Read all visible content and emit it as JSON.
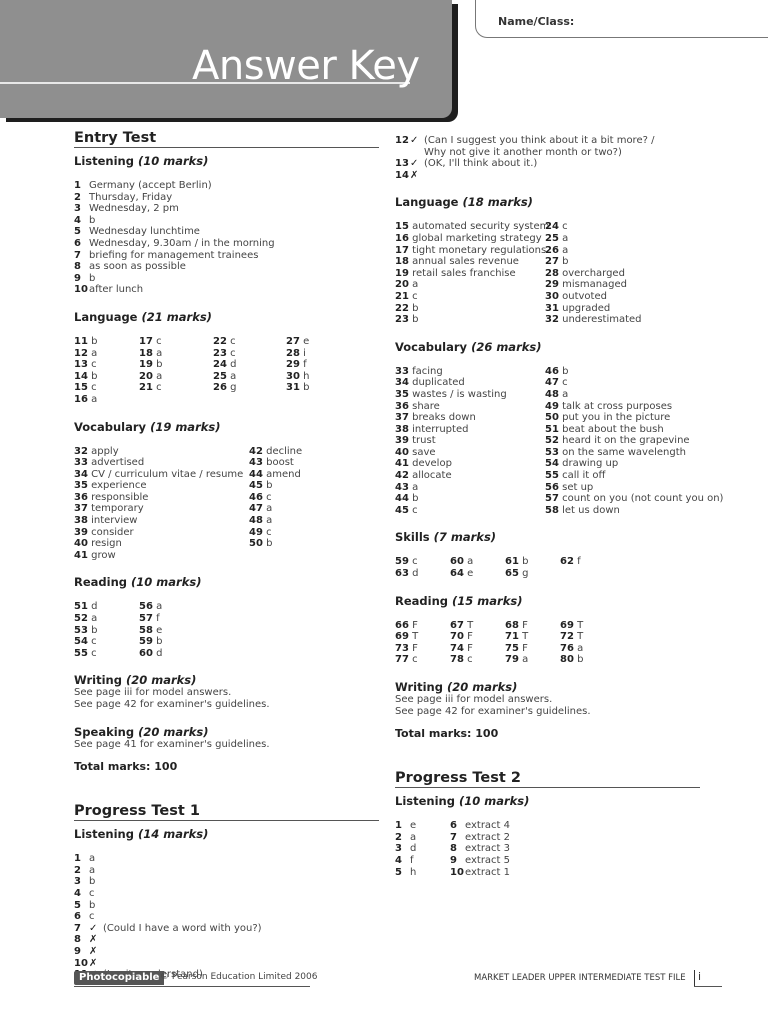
{
  "header": {
    "title": "Answer Key",
    "name_label": "Name/Class:"
  },
  "entry_test": {
    "title": "Entry Test",
    "listening": {
      "label": "Listening",
      "marks": "(10 marks)",
      "items": [
        {
          "n": "1",
          "a": "Germany (accept Berlin)"
        },
        {
          "n": "2",
          "a": "Thursday, Friday"
        },
        {
          "n": "3",
          "a": "Wednesday, 2 pm"
        },
        {
          "n": "4",
          "a": "b"
        },
        {
          "n": "5",
          "a": "Wednesday lunchtime"
        },
        {
          "n": "6",
          "a": "Wednesday, 9.30am / in the morning"
        },
        {
          "n": "7",
          "a": "briefing for management trainees"
        },
        {
          "n": "8",
          "a": "as soon as possible"
        },
        {
          "n": "9",
          "a": "b"
        },
        {
          "n": "10",
          "a": "after lunch"
        }
      ]
    },
    "language": {
      "label": "Language",
      "marks": "(21 marks)",
      "items": [
        {
          "n": "11",
          "a": "b"
        },
        {
          "n": "17",
          "a": "c"
        },
        {
          "n": "22",
          "a": "c"
        },
        {
          "n": "27",
          "a": "e"
        },
        {
          "n": "12",
          "a": "a"
        },
        {
          "n": "18",
          "a": "a"
        },
        {
          "n": "23",
          "a": "c"
        },
        {
          "n": "28",
          "a": "i"
        },
        {
          "n": "13",
          "a": "c"
        },
        {
          "n": "19",
          "a": "b"
        },
        {
          "n": "24",
          "a": "d"
        },
        {
          "n": "29",
          "a": "f"
        },
        {
          "n": "14",
          "a": "b"
        },
        {
          "n": "20",
          "a": "a"
        },
        {
          "n": "25",
          "a": "a"
        },
        {
          "n": "30",
          "a": "h"
        },
        {
          "n": "15",
          "a": "c"
        },
        {
          "n": "21",
          "a": "c"
        },
        {
          "n": "26",
          "a": "g"
        },
        {
          "n": "31",
          "a": "b"
        },
        {
          "n": "16",
          "a": "a"
        }
      ]
    },
    "vocabulary": {
      "label": "Vocabulary",
      "marks": "(19 marks)",
      "items": [
        {
          "n": "32",
          "a": "apply"
        },
        {
          "n": "42",
          "a": "decline"
        },
        {
          "n": "33",
          "a": "advertised"
        },
        {
          "n": "43",
          "a": "boost"
        },
        {
          "n": "34",
          "a": "CV / curriculum vitae / resume"
        },
        {
          "n": "44",
          "a": "amend"
        },
        {
          "n": "35",
          "a": "experience"
        },
        {
          "n": "45",
          "a": "b"
        },
        {
          "n": "36",
          "a": "responsible"
        },
        {
          "n": "46",
          "a": "c"
        },
        {
          "n": "37",
          "a": "temporary"
        },
        {
          "n": "47",
          "a": "a"
        },
        {
          "n": "38",
          "a": "interview"
        },
        {
          "n": "48",
          "a": "a"
        },
        {
          "n": "39",
          "a": "consider"
        },
        {
          "n": "49",
          "a": "c"
        },
        {
          "n": "40",
          "a": "resign"
        },
        {
          "n": "50",
          "a": "b"
        },
        {
          "n": "41",
          "a": "grow"
        }
      ]
    },
    "reading": {
      "label": "Reading",
      "marks": "(10 marks)",
      "items": [
        {
          "n": "51",
          "a": "d"
        },
        {
          "n": "56",
          "a": "a"
        },
        {
          "n": "52",
          "a": "a"
        },
        {
          "n": "57",
          "a": "f"
        },
        {
          "n": "53",
          "a": "b"
        },
        {
          "n": "58",
          "a": "e"
        },
        {
          "n": "54",
          "a": "c"
        },
        {
          "n": "59",
          "a": "b"
        },
        {
          "n": "55",
          "a": "c"
        },
        {
          "n": "60",
          "a": "d"
        }
      ]
    },
    "writing": {
      "label": "Writing",
      "marks": "(20 marks)",
      "lines": [
        "See page iii for model answers.",
        "See page 42 for examiner's guidelines."
      ]
    },
    "speaking": {
      "label": "Speaking",
      "marks": "(20 marks)",
      "lines": [
        "See page 41 for examiner's guidelines."
      ]
    },
    "total": "Total marks: 100"
  },
  "progress_test_1": {
    "title": "Progress Test 1",
    "listening": {
      "label": "Listening",
      "marks": "(14 marks)",
      "items": [
        {
          "n": "1",
          "m": "",
          "a": "a"
        },
        {
          "n": "2",
          "m": "",
          "a": "a"
        },
        {
          "n": "3",
          "m": "",
          "a": "b"
        },
        {
          "n": "4",
          "m": "",
          "a": "c"
        },
        {
          "n": "5",
          "m": "",
          "a": "b"
        },
        {
          "n": "6",
          "m": "",
          "a": "c"
        },
        {
          "n": "7",
          "m": "✓",
          "a": "(Could I have a word with you?)"
        },
        {
          "n": "8",
          "m": "✗",
          "a": ""
        },
        {
          "n": "9",
          "m": "✗",
          "a": ""
        },
        {
          "n": "10",
          "m": "✗",
          "a": ""
        },
        {
          "n": "11",
          "m": "✓",
          "a": "(I quite understand)"
        },
        {
          "n": "12",
          "m": "✓",
          "a": "(Can I suggest you think about it a bit more? / Why not give it another month or two?)"
        },
        {
          "n": "13",
          "m": "✓",
          "a": "(OK, I'll think about it.)"
        },
        {
          "n": "14",
          "m": "✗",
          "a": ""
        }
      ]
    },
    "language": {
      "label": "Language",
      "marks": "(18 marks)",
      "items": [
        {
          "n": "15",
          "a": "automated security system"
        },
        {
          "n": "24",
          "a": "c"
        },
        {
          "n": "16",
          "a": "global marketing strategy"
        },
        {
          "n": "25",
          "a": "a"
        },
        {
          "n": "17",
          "a": "tight monetary regulations"
        },
        {
          "n": "26",
          "a": "a"
        },
        {
          "n": "18",
          "a": "annual sales revenue"
        },
        {
          "n": "27",
          "a": "b"
        },
        {
          "n": "19",
          "a": "retail sales franchise"
        },
        {
          "n": "28",
          "a": "overcharged"
        },
        {
          "n": "20",
          "a": "a"
        },
        {
          "n": "29",
          "a": "mismanaged"
        },
        {
          "n": "21",
          "a": "c"
        },
        {
          "n": "30",
          "a": "outvoted"
        },
        {
          "n": "22",
          "a": "b"
        },
        {
          "n": "31",
          "a": "upgraded"
        },
        {
          "n": "23",
          "a": "b"
        },
        {
          "n": "32",
          "a": "underestimated"
        }
      ]
    },
    "vocabulary": {
      "label": "Vocabulary",
      "marks": "(26 marks)",
      "items": [
        {
          "n": "33",
          "a": "facing"
        },
        {
          "n": "46",
          "a": "b"
        },
        {
          "n": "34",
          "a": "duplicated"
        },
        {
          "n": "47",
          "a": "c"
        },
        {
          "n": "35",
          "a": "wastes / is wasting"
        },
        {
          "n": "48",
          "a": "a"
        },
        {
          "n": "36",
          "a": "share"
        },
        {
          "n": "49",
          "a": "talk at cross purposes"
        },
        {
          "n": "37",
          "a": "breaks down"
        },
        {
          "n": "50",
          "a": "put you in the picture"
        },
        {
          "n": "38",
          "a": "interrupted"
        },
        {
          "n": "51",
          "a": "beat about the bush"
        },
        {
          "n": "39",
          "a": "trust"
        },
        {
          "n": "52",
          "a": "heard it on the grapevine"
        },
        {
          "n": "40",
          "a": "save"
        },
        {
          "n": "53",
          "a": "on the same wavelength"
        },
        {
          "n": "41",
          "a": "develop"
        },
        {
          "n": "54",
          "a": "drawing up"
        },
        {
          "n": "42",
          "a": "allocate"
        },
        {
          "n": "55",
          "a": "call it off"
        },
        {
          "n": "43",
          "a": "a"
        },
        {
          "n": "56",
          "a": "set up"
        },
        {
          "n": "44",
          "a": "b"
        },
        {
          "n": "57",
          "a": "count on you (not count you on)"
        },
        {
          "n": "45",
          "a": "c"
        },
        {
          "n": "58",
          "a": "let us down"
        }
      ]
    },
    "skills": {
      "label": "Skills",
      "marks": "(7 marks)",
      "items": [
        {
          "n": "59",
          "a": "c"
        },
        {
          "n": "60",
          "a": "a"
        },
        {
          "n": "61",
          "a": "b"
        },
        {
          "n": "62",
          "a": "f"
        },
        {
          "n": "63",
          "a": "d"
        },
        {
          "n": "64",
          "a": "e"
        },
        {
          "n": "65",
          "a": "g"
        }
      ]
    },
    "reading": {
      "label": "Reading",
      "marks": "(15 marks)",
      "items": [
        {
          "n": "66",
          "a": "F"
        },
        {
          "n": "67",
          "a": "T"
        },
        {
          "n": "68",
          "a": "F"
        },
        {
          "n": "69",
          "a": "T"
        },
        {
          "n": "69",
          "a": "T"
        },
        {
          "n": "70",
          "a": "F"
        },
        {
          "n": "71",
          "a": "T"
        },
        {
          "n": "72",
          "a": "T"
        },
        {
          "n": "73",
          "a": "F"
        },
        {
          "n": "74",
          "a": "F"
        },
        {
          "n": "75",
          "a": "F"
        },
        {
          "n": "76",
          "a": "a"
        },
        {
          "n": "77",
          "a": "c"
        },
        {
          "n": "78",
          "a": "c"
        },
        {
          "n": "79",
          "a": "a"
        },
        {
          "n": "80",
          "a": "b"
        }
      ]
    },
    "writing": {
      "label": "Writing",
      "marks": "(20 marks)",
      "lines": [
        "See page iii for model answers.",
        "See page 42 for examiner's guidelines."
      ]
    },
    "total": "Total marks: 100"
  },
  "progress_test_2": {
    "title": "Progress Test 2",
    "listening": {
      "label": "Listening",
      "marks": "(10 marks)",
      "items": [
        {
          "n": "1",
          "a": "e"
        },
        {
          "n": "6",
          "a": "extract 4"
        },
        {
          "n": "2",
          "a": "a"
        },
        {
          "n": "7",
          "a": "extract 2"
        },
        {
          "n": "3",
          "a": "d"
        },
        {
          "n": "8",
          "a": "extract 3"
        },
        {
          "n": "4",
          "a": "f"
        },
        {
          "n": "9",
          "a": "extract 5"
        },
        {
          "n": "5",
          "a": "h"
        },
        {
          "n": "10",
          "a": "extract 1"
        }
      ]
    }
  },
  "footer": {
    "badge": "Photocopiable",
    "copyright": "© Pearson Education Limited 2006",
    "book_title": "MARKET LEADER UPPER INTERMEDIATE TEST FILE",
    "page": "i"
  }
}
